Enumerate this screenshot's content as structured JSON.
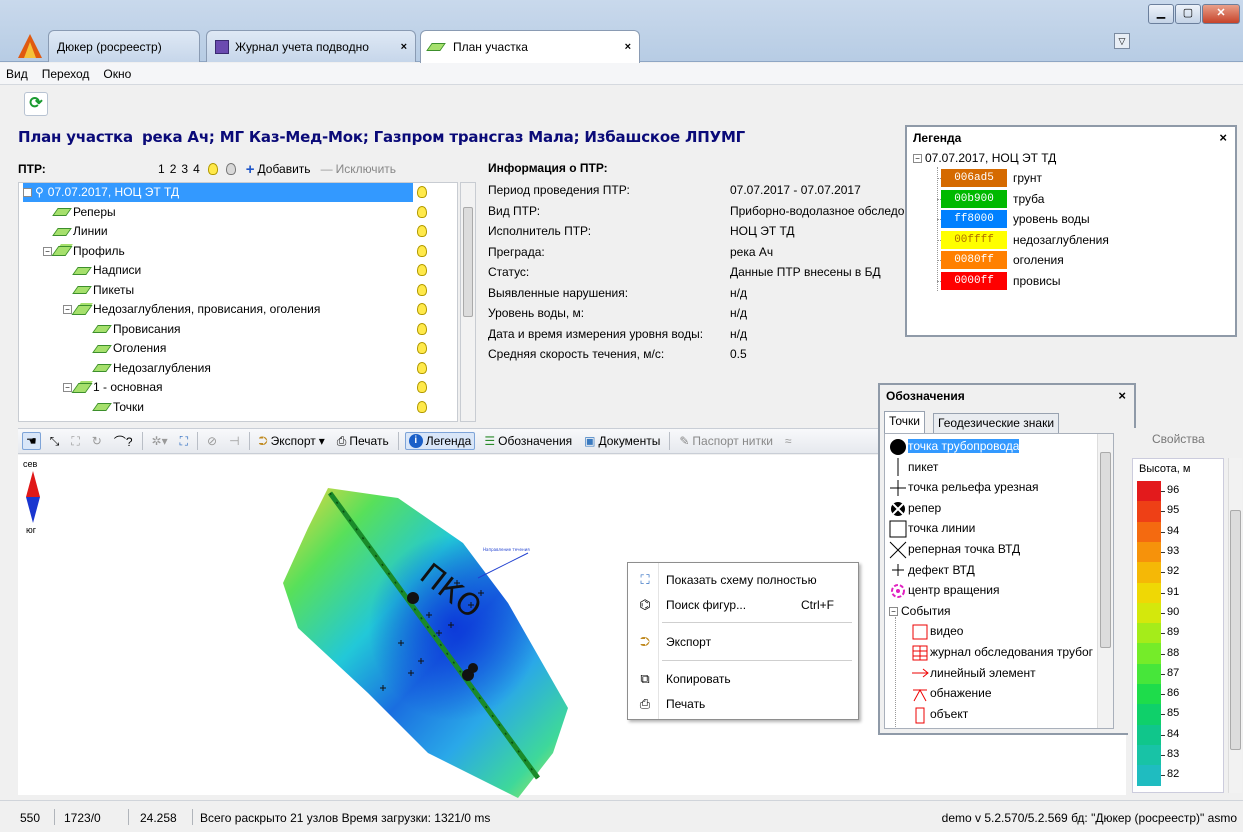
{
  "tabs": [
    {
      "label": "Дюкер (росреестр)",
      "close": ""
    },
    {
      "label": "Журнал учета подводно",
      "close": "×"
    },
    {
      "label": "План участка",
      "close": "×"
    }
  ],
  "menu": [
    "Вид",
    "Переход",
    "Окно"
  ],
  "plan_title": {
    "prefix": "План участка",
    "rest": "река Ач; МГ Каз-Мед-Мок; Газпром трансгаз Мала; Избашское ЛПУМГ"
  },
  "ptr": {
    "label": "ПТР:",
    "pages": [
      "1",
      "2",
      "3",
      "4"
    ],
    "add": "Добавить",
    "remove": "Исключить"
  },
  "tree": [
    {
      "label": "07.07.2017, НОЦ ЭТ ТД",
      "level": 0,
      "expander": "−",
      "icon": "person",
      "selected": true
    },
    {
      "label": "Реперы",
      "level": 1,
      "icon": "layer"
    },
    {
      "label": "Линии",
      "level": 1,
      "icon": "layer"
    },
    {
      "label": "Профиль",
      "level": 1,
      "expander": "−",
      "icon": "layers"
    },
    {
      "label": "Надписи",
      "level": 2,
      "icon": "layer"
    },
    {
      "label": "Пикеты",
      "level": 2,
      "icon": "layer"
    },
    {
      "label": "Недозаглубления, провисания, оголения",
      "level": 2,
      "expander": "−",
      "icon": "layers"
    },
    {
      "label": "Провисания",
      "level": 3,
      "icon": "layer"
    },
    {
      "label": "Оголения",
      "level": 3,
      "icon": "layer"
    },
    {
      "label": "Недозаглубления",
      "level": 3,
      "icon": "layer"
    },
    {
      "label": "1 - основная",
      "level": 2,
      "expander": "−",
      "icon": "layers"
    },
    {
      "label": "Точки",
      "level": 3,
      "icon": "layer"
    }
  ],
  "info": {
    "title": "Информация о ПТР:",
    "rows": [
      {
        "k": "Период проведения ПТР:",
        "v": "07.07.2017 - 07.07.2017"
      },
      {
        "k": "Вид ПТР:",
        "v": "Приборно-водолазное обследо"
      },
      {
        "k": "Исполнитель ПТР:",
        "v": "НОЦ ЭТ ТД"
      },
      {
        "k": "Преграда:",
        "v": "река Ач"
      },
      {
        "k": "Статус:",
        "v": "Данные ПТР внесены в БД"
      },
      {
        "k": "Выявленные нарушения:",
        "v": "н/д"
      },
      {
        "k": "Уровень воды, м:",
        "v": "н/д"
      },
      {
        "k": "Дата и время измерения уровня воды:",
        "v": "н/д"
      },
      {
        "k": "Средняя скорость течения, м/с:",
        "v": "0.5"
      }
    ]
  },
  "legend": {
    "title": "Легенда",
    "close": "×",
    "root": "07.07.2017, НОЦ ЭТ ТД",
    "items": [
      {
        "code": "006ad5",
        "label": "грунт",
        "color": "#d56a00"
      },
      {
        "code": "00b900",
        "label": "труба",
        "color": "#00b900"
      },
      {
        "code": "ff8000",
        "label": "уровень воды",
        "color": "#0080ff"
      },
      {
        "code": "00ffff",
        "label": "недозаглубления",
        "color": "#ffff00"
      },
      {
        "code": "0080ff",
        "label": "оголения",
        "color": "#ff8000"
      },
      {
        "code": "0000ff",
        "label": "провисы",
        "color": "#ff0000"
      }
    ]
  },
  "toolbar": {
    "export": "Экспорт",
    "print": "Печать",
    "legend": "Легенда",
    "symbols": "Обозначения",
    "documents": "Документы",
    "passport": "Паспорт нитки",
    "properties": "Свойства"
  },
  "compass": {
    "north": "сев",
    "south": "юг"
  },
  "map": {
    "label": "ПКО",
    "annotation": "Направление течения"
  },
  "context_menu": [
    {
      "label": "Показать схему полностью",
      "shortcut": "",
      "icon": "fit-icon"
    },
    {
      "label": "Поиск фигур...",
      "shortcut": "Ctrl+F",
      "icon": "binoculars-icon"
    },
    {
      "label": "Экспорт",
      "shortcut": "",
      "icon": "export-icon"
    },
    {
      "label": "Копировать",
      "shortcut": "",
      "icon": "copy-icon"
    },
    {
      "label": "Печать",
      "shortcut": "",
      "icon": "print-icon"
    }
  ],
  "symbols": {
    "title": "Обозначения",
    "close": "×",
    "tabs": [
      "Точки",
      "Геодезические знаки"
    ],
    "items": [
      {
        "label": "точка трубопровода",
        "symbol": "filled-circle",
        "selected": true
      },
      {
        "label": "пикет",
        "symbol": "vline"
      },
      {
        "label": "точка рельефа урезная",
        "symbol": "cross"
      },
      {
        "label": "репер",
        "symbol": "benchmark"
      },
      {
        "label": "точка линии",
        "symbol": "square"
      },
      {
        "label": "реперная точка ВТД",
        "symbol": "x"
      },
      {
        "label": "дефект ВТД",
        "symbol": "cross-small"
      },
      {
        "label": "центр вращения",
        "symbol": "rotate"
      }
    ],
    "events_label": "События",
    "events": [
      {
        "label": "видео",
        "symbol": "video"
      },
      {
        "label": "журнал обследования трубог",
        "symbol": "journal"
      },
      {
        "label": "линейный элемент",
        "symbol": "linear"
      },
      {
        "label": "обнажение",
        "symbol": "exposure"
      },
      {
        "label": "объект",
        "symbol": "object"
      }
    ]
  },
  "elevation": {
    "title": "Высота, м",
    "ticks": [
      "96",
      "95",
      "94",
      "93",
      "92",
      "91",
      "90",
      "89",
      "88",
      "87",
      "86",
      "85",
      "84",
      "83",
      "82"
    ],
    "colors": [
      "#e31a1c",
      "#ee4016",
      "#f46a10",
      "#f6920b",
      "#f5b806",
      "#efd805",
      "#d4e80c",
      "#a5ec1a",
      "#75ec29",
      "#47e63a",
      "#1edc4b",
      "#0fd06a",
      "#10c68b",
      "#18c3a6",
      "#1fbcc0"
    ]
  },
  "status": {
    "a": "550",
    "b": "1723/0",
    "c": "24.258",
    "d": "Всего раскрыто 21 узлов  Время загрузки: 1321/0 ms",
    "right": "demo  v 5.2.570/5.2.569  бд: \"Дюкер (росреестр)\" asmo"
  }
}
